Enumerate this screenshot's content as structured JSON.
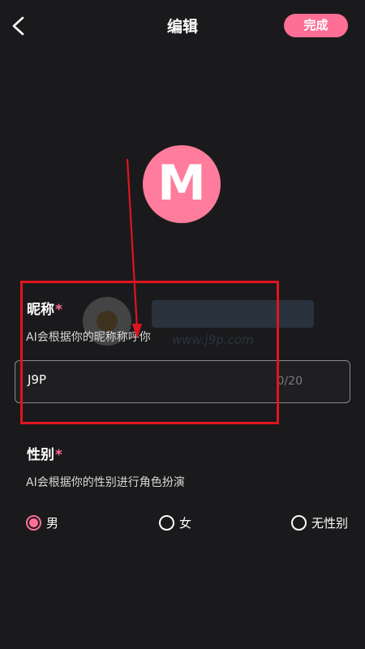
{
  "header": {
    "back_icon": "chevron-left-icon",
    "title": "编辑",
    "done_label": "完成"
  },
  "avatar": {
    "letter": "M",
    "bg_color": "#ff7c9c"
  },
  "nickname": {
    "label": "昵称",
    "required_mark": "*",
    "hint": "AI会根据你的昵称称呼你",
    "value": "J9P",
    "counter": "0/20"
  },
  "gender": {
    "label": "性别",
    "required_mark": "*",
    "hint": "AI会根据你的性别进行角色扮演",
    "options": [
      {
        "label": "男",
        "selected": true
      },
      {
        "label": "女",
        "selected": false
      },
      {
        "label": "无性别",
        "selected": false
      }
    ]
  },
  "colors": {
    "accent": "#ff6f95",
    "background": "#1a1a1c",
    "annotation": "#e0141e"
  },
  "watermark": {
    "text": "www.j9p.com"
  }
}
